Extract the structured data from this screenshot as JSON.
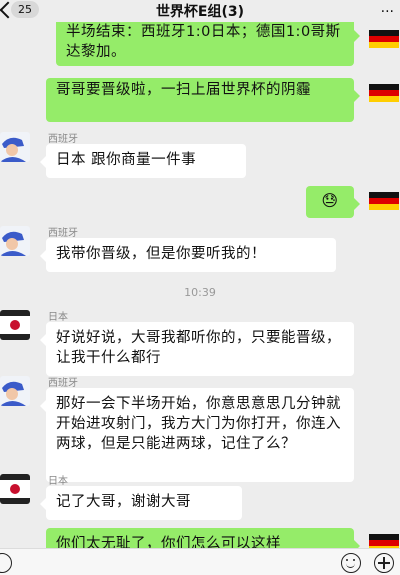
{
  "header": {
    "unread_count": "25",
    "title": "世界杯E组(3)",
    "more_label": "···"
  },
  "contacts": {
    "spain": "西班牙",
    "japan": "日本"
  },
  "messages": [
    {
      "text": "半场结束：西班牙1:0日本；德国1:0哥斯达黎加。"
    },
    {
      "text": "哥哥要晋级啦，一扫上届世界杯的阴霾"
    },
    {
      "text": "日本 跟你商量一件事"
    },
    {
      "text": "😓"
    },
    {
      "text": "我带你晋级，但是你要听我的！"
    },
    {
      "text": "好说好说，大哥我都听你的，只要能晋级，让我干什么都行"
    },
    {
      "text": "那好一会下半场开始，你意思意思几分钟就开始进攻射门，我方大门为你打开，你连入两球，但是只能进两球，记住了么？"
    },
    {
      "text": "记了大哥，谢谢大哥"
    },
    {
      "text": "你们太无耻了，你们怎么可以这样"
    }
  ],
  "timestamp": "10:39",
  "avatars": {
    "germany": "germany-flag-icon",
    "spain": "spain-player-icon",
    "japan": "japan-flag-icon"
  },
  "colors": {
    "outgoing_bubble": "#95ec69",
    "incoming_bubble": "#ffffff",
    "background": "#ededed"
  }
}
